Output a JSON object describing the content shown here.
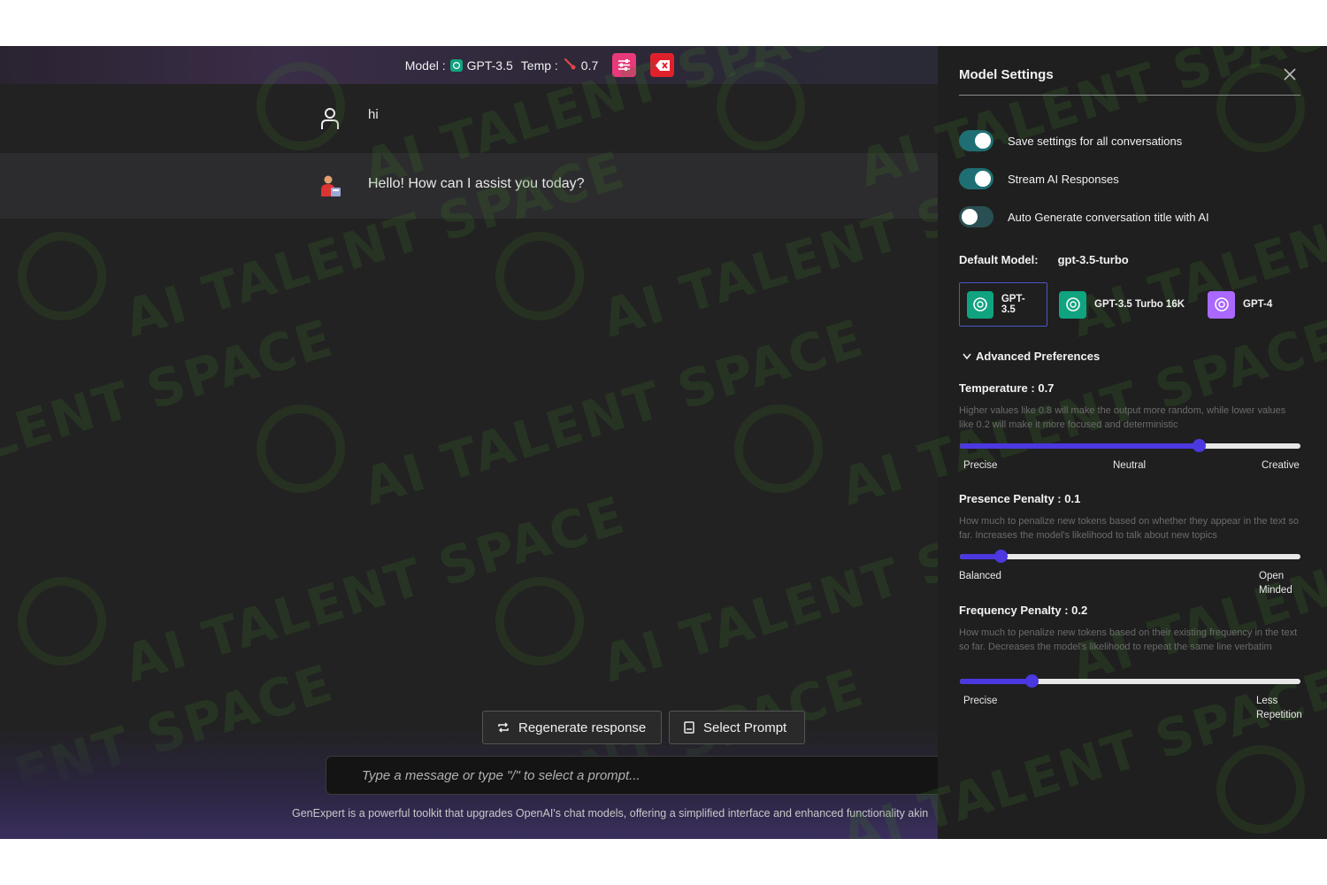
{
  "topbar": {
    "model_label": "Model :",
    "model_value": "GPT-3.5",
    "temp_label": "Temp :",
    "temp_value": "0.7"
  },
  "messages": [
    {
      "role": "user",
      "text": "hi"
    },
    {
      "role": "assistant",
      "text": "Hello! How can I assist you today?"
    }
  ],
  "actions": {
    "regenerate_label": "Regenerate response",
    "select_prompt_label": "Select Prompt"
  },
  "input": {
    "placeholder": "Type a message or type \"/\" to select a prompt..."
  },
  "footer": {
    "text": "GenExpert is a powerful toolkit that upgrades OpenAI's chat models, offering a simplified interface and enhanced functionality akin"
  },
  "watermark": {
    "text": "AI TALENT SPACE"
  },
  "settings": {
    "title": "Model Settings",
    "toggles": [
      {
        "label": "Save settings for all conversations",
        "on": true
      },
      {
        "label": "Stream AI Responses",
        "on": true
      },
      {
        "label": "Auto Generate conversation title with AI",
        "on": false
      }
    ],
    "default_model_label": "Default Model:",
    "default_model_value": "gpt-3.5-turbo",
    "models": [
      {
        "label": "GPT-3.5",
        "color": "#10a37f",
        "selected": true
      },
      {
        "label": "GPT-3.5 Turbo 16K",
        "color": "#10a37f",
        "selected": false
      },
      {
        "label": "GPT-4",
        "color": "#ab68ff",
        "selected": false
      }
    ],
    "advanced_label": "Advanced Preferences",
    "temperature": {
      "title": "Temperature : 0.7",
      "description": "Higher values like 0.8 will make the output more random, while lower values like 0.2 will make it more focused and deterministic",
      "value_fraction": 0.7,
      "labels": [
        "Precise",
        "Neutral",
        "Creative"
      ]
    },
    "presence": {
      "title": "Presence Penalty : 0.1",
      "description": "How much to penalize new tokens based on whether they appear in the text so far. Increases the model's likelihood to talk about new topics",
      "value_fraction": 0.12,
      "labels": [
        "Balanced",
        "Open Minded"
      ]
    },
    "frequency": {
      "title": "Frequency Penalty : 0.2",
      "description": "How much to penalize new tokens based on their existing frequency in the text so far. Decreases the model's likelihood to repeat the same line verbatim",
      "value_fraction": 0.21,
      "labels": [
        "Precise",
        "Less Repetition"
      ]
    }
  },
  "colors": {
    "accent": "#4b38e0",
    "toggle_on": "#1e6f73",
    "settings_button": "#e83a7a",
    "clear_button": "#e0212c"
  }
}
